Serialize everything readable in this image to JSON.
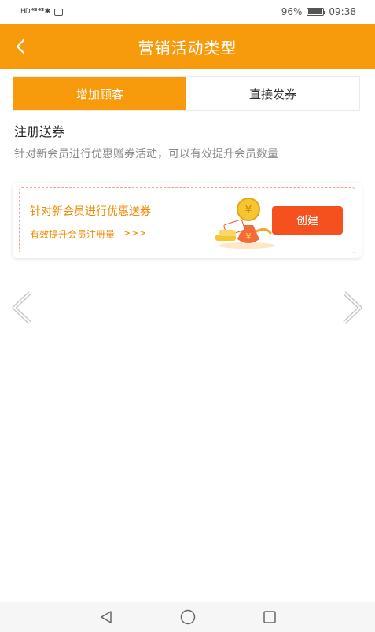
{
  "status_bar": {
    "left_indicators": "HD ⁴⁶ˡˡˡ ⁴⁶ˡˡˡ ✱",
    "battery_percent": "96%",
    "time": "09:38"
  },
  "header": {
    "title": "营销活动类型",
    "accent_color": "#f79b0d"
  },
  "tabs": [
    {
      "label": "增加顾客",
      "active": true
    },
    {
      "label": "直接发券",
      "active": false
    }
  ],
  "section": {
    "title": "注册送券",
    "description": "针对新会员进行优惠赠券活动，可以有效提升会员数量"
  },
  "promo_card": {
    "headline": "针对新会员进行优惠送券",
    "subtext": "有效提升会员注册量",
    "chevrons": ">>>",
    "button_label": "创建",
    "button_color": "#f4511e"
  },
  "icons": [
    "back-icon",
    "coin-bag-icon",
    "chevron-left-icon",
    "chevron-right-icon",
    "nav-back-icon",
    "nav-home-icon",
    "nav-recent-icon"
  ]
}
